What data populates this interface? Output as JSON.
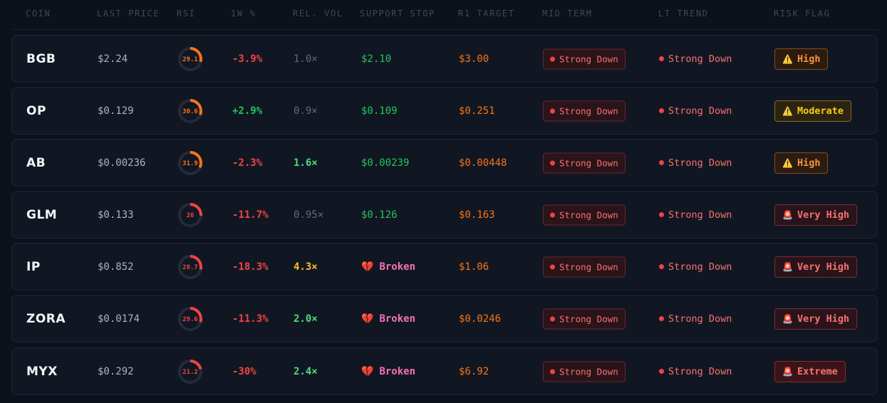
{
  "header": {
    "coin": "COIN",
    "last_price": "LAST PRICE",
    "rsi": "RSI",
    "week_pct": "1W %",
    "rel_vol": "REL. VOL",
    "support_stop": "SUPPORT STOP",
    "r1_target": "R1 TARGET",
    "mid_term": "MID TERM",
    "lt_trend": "LT TREND",
    "risk_flag": "RISK FLAG"
  },
  "colors": {
    "rsi_orange": "#f97316",
    "rsi_red": "#ef4444",
    "track": "#232b3a"
  },
  "rows": [
    {
      "coin": "BGB",
      "price": "$2.24",
      "rsi": 29.1,
      "rsi_text": "29.1",
      "rsi_color": "orange",
      "pct": "-3.9%",
      "pct_sign": "neg",
      "vol": "1.0×",
      "vol_style": "dim",
      "support": "$2.10",
      "support_broken": false,
      "target": "$3.00",
      "mid": "Strong Down",
      "lt": "Strong Down",
      "risk": "High",
      "risk_style": "high",
      "risk_icon": "warning-icon"
    },
    {
      "coin": "OP",
      "price": "$0.129",
      "rsi": 30.6,
      "rsi_text": "30.6",
      "rsi_color": "orange",
      "pct": "+2.9%",
      "pct_sign": "pos",
      "vol": "0.9×",
      "vol_style": "dim",
      "support": "$0.109",
      "support_broken": false,
      "target": "$0.251",
      "mid": "Strong Down",
      "lt": "Strong Down",
      "risk": "Moderate",
      "risk_style": "moderate",
      "risk_icon": "warning-icon"
    },
    {
      "coin": "AB",
      "price": "$0.00236",
      "rsi": 31.9,
      "rsi_text": "31.9",
      "rsi_color": "orange",
      "pct": "-2.3%",
      "pct_sign": "neg",
      "vol": "1.6×",
      "vol_style": "hi",
      "support": "$0.00239",
      "support_broken": false,
      "target": "$0.00448",
      "mid": "Strong Down",
      "lt": "Strong Down",
      "risk": "High",
      "risk_style": "high",
      "risk_icon": "warning-icon"
    },
    {
      "coin": "GLM",
      "price": "$0.133",
      "rsi": 26,
      "rsi_text": "26",
      "rsi_color": "red",
      "pct": "-11.7%",
      "pct_sign": "neg",
      "vol": "0.95×",
      "vol_style": "dim",
      "support": "$0.126",
      "support_broken": false,
      "target": "$0.163",
      "mid": "Strong Down",
      "lt": "Strong Down",
      "risk": "Very High",
      "risk_style": "veryhigh",
      "risk_icon": "siren-icon"
    },
    {
      "coin": "IP",
      "price": "$0.852",
      "rsi": 28.7,
      "rsi_text": "28.7",
      "rsi_color": "red",
      "pct": "-18.3%",
      "pct_sign": "neg",
      "vol": "4.3×",
      "vol_style": "warn",
      "support": "Broken",
      "support_broken": true,
      "target": "$1.06",
      "mid": "Strong Down",
      "lt": "Strong Down",
      "risk": "Very High",
      "risk_style": "veryhigh",
      "risk_icon": "siren-icon"
    },
    {
      "coin": "ZORA",
      "price": "$0.0174",
      "rsi": 29.6,
      "rsi_text": "29.6",
      "rsi_color": "red",
      "pct": "-11.3%",
      "pct_sign": "neg",
      "vol": "2.0×",
      "vol_style": "hi",
      "support": "Broken",
      "support_broken": true,
      "target": "$0.0246",
      "mid": "Strong Down",
      "lt": "Strong Down",
      "risk": "Very High",
      "risk_style": "veryhigh",
      "risk_icon": "siren-icon"
    },
    {
      "coin": "MYX",
      "price": "$0.292",
      "rsi": 21.2,
      "rsi_text": "21.2",
      "rsi_color": "red",
      "pct": "-30%",
      "pct_sign": "neg",
      "vol": "2.4×",
      "vol_style": "hi",
      "support": "Broken",
      "support_broken": true,
      "target": "$6.92",
      "mid": "Strong Down",
      "lt": "Strong Down",
      "risk": "Extreme",
      "risk_style": "extreme",
      "risk_icon": "siren-icon"
    }
  ]
}
